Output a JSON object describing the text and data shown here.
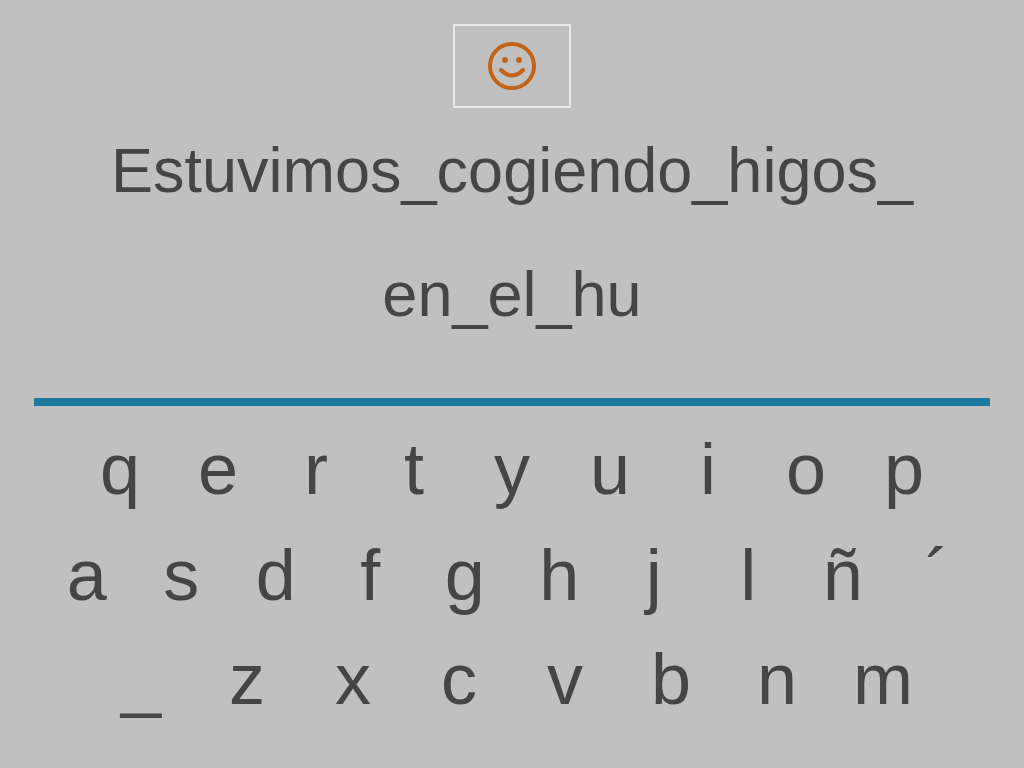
{
  "sentence": [
    "Estuvimos_cogiendo_higos_",
    "en_el_hu"
  ],
  "keyboard": {
    "rows": [
      [
        "q",
        "e",
        "r",
        "t",
        "y",
        "u",
        "i",
        "o",
        "p"
      ],
      [
        "a",
        "s",
        "d",
        "f",
        "g",
        "h",
        "j",
        "l",
        "ñ",
        "´"
      ],
      [
        "_",
        "z",
        "x",
        "c",
        "v",
        "b",
        "n",
        "m"
      ]
    ]
  }
}
